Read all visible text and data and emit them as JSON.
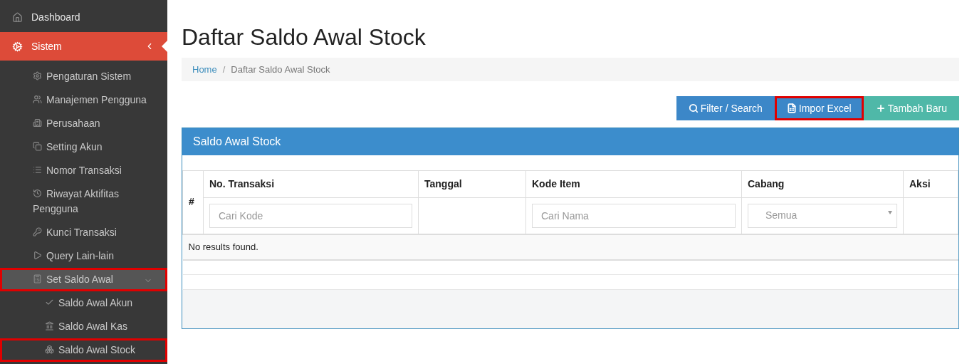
{
  "sidebar": {
    "items": [
      {
        "label": "Dashboard",
        "selected": false,
        "highlighted": false
      },
      {
        "label": "Sistem",
        "selected": true,
        "highlighted": false,
        "expanded": true,
        "children": [
          {
            "label": "Pengaturan Sistem",
            "highlighted": false
          },
          {
            "label": "Manajemen Pengguna",
            "highlighted": false
          },
          {
            "label": "Perusahaan",
            "highlighted": false
          },
          {
            "label": "Setting Akun",
            "highlighted": false
          },
          {
            "label": "Nomor Transaksi",
            "highlighted": false
          },
          {
            "label": "Riwayat Aktifitas Pengguna",
            "highlighted": false
          },
          {
            "label": "Kunci Transaksi",
            "highlighted": false
          },
          {
            "label": "Query Lain-lain",
            "highlighted": false
          },
          {
            "label": "Set Saldo Awal",
            "highlighted": true,
            "expanded": true,
            "children": [
              {
                "label": "Saldo Awal Akun",
                "highlighted": false
              },
              {
                "label": "Saldo Awal Kas",
                "highlighted": false
              },
              {
                "label": "Saldo Awal Stock",
                "highlighted": true
              }
            ]
          }
        ]
      }
    ]
  },
  "page_title": "Daftar Saldo Awal Stock",
  "breadcrumb": [
    {
      "label": "Home",
      "kind": "link"
    },
    {
      "label": "Daftar Saldo Awal Stock",
      "kind": "current"
    }
  ],
  "breadcrumb_separator": "/",
  "toolbar": [
    {
      "label": "Filter / Search",
      "kind": "search",
      "highlighted": false
    },
    {
      "label": "Impor Excel",
      "kind": "excel",
      "highlighted": true
    },
    {
      "label": "Tambah Baru",
      "kind": "add",
      "highlighted": false
    }
  ],
  "panel": {
    "title": "Saldo Awal Stock",
    "table": {
      "columns": [
        {
          "label": "#"
        },
        {
          "label": "No. Transaksi",
          "filter": {
            "kind": "text",
            "placeholder": "Cari Kode"
          }
        },
        {
          "label": "Tanggal"
        },
        {
          "label": "Kode Item",
          "filter": {
            "kind": "text",
            "placeholder": "Cari Nama"
          }
        },
        {
          "label": "Cabang",
          "filter": {
            "kind": "select",
            "value": "Semua"
          }
        },
        {
          "label": "Aksi"
        }
      ],
      "empty_message": "No results found."
    }
  }
}
